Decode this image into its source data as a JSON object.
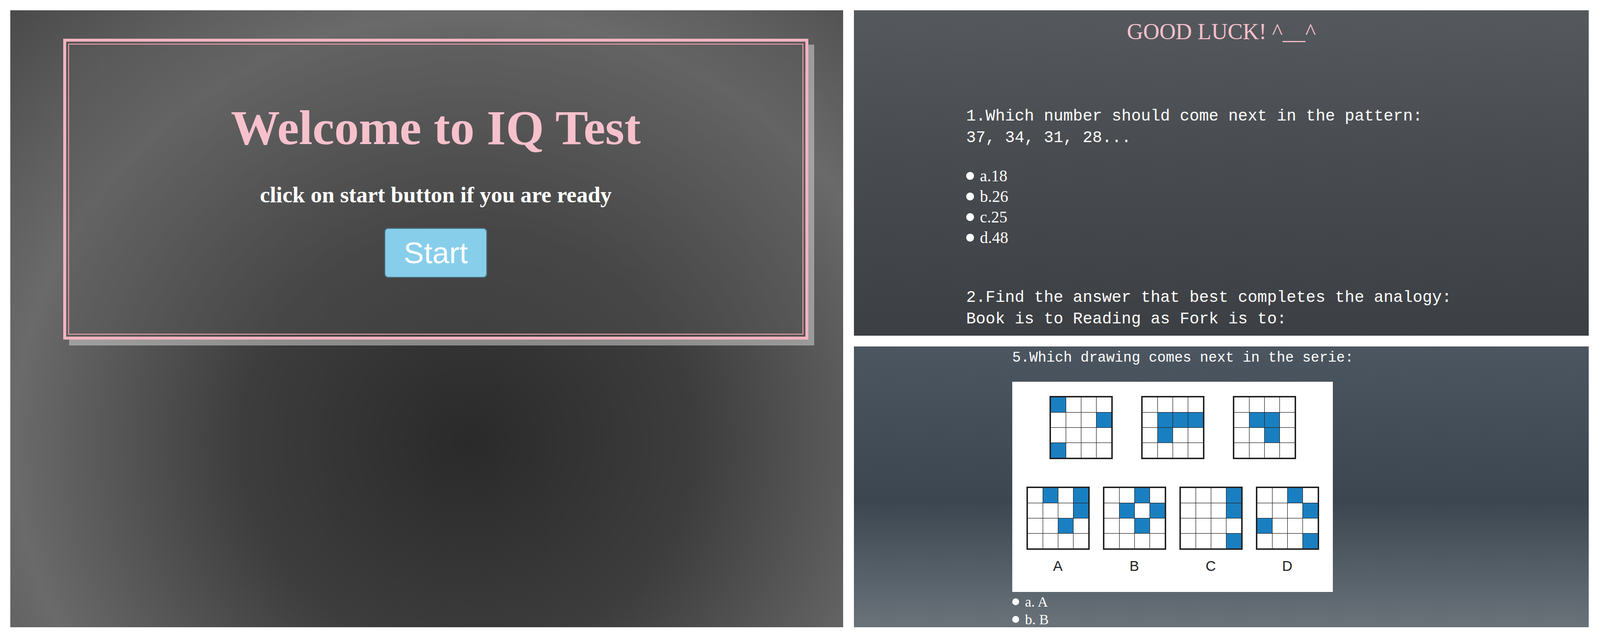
{
  "welcome": {
    "title": "Welcome to IQ Test",
    "subtitle": "click on start button if you are ready",
    "button": "Start"
  },
  "quiz_top": {
    "header": "GOOD LUCK! ^__^",
    "questions": [
      {
        "lines": [
          "1.Which number should come next in the pattern:",
          "37, 34, 31, 28..."
        ],
        "options": [
          "a.18",
          "b.26",
          "c.25",
          "d.48"
        ]
      },
      {
        "lines": [
          "2.Find the answer that best completes the analogy:",
          "Book is to Reading as Fork is to:"
        ],
        "options": []
      }
    ]
  },
  "quiz_bottom": {
    "question": "5.Which drawing comes next in the serie:",
    "series": [
      {
        "filled": [
          0,
          7,
          12
        ]
      },
      {
        "filled": [
          5,
          6,
          7,
          9
        ]
      },
      {
        "filled": [
          5,
          6,
          10
        ]
      }
    ],
    "choices": [
      {
        "label": "A",
        "filled": [
          1,
          3,
          7,
          10
        ]
      },
      {
        "label": "B",
        "filled": [
          2,
          5,
          7,
          10
        ]
      },
      {
        "label": "C",
        "filled": [
          3,
          7,
          15
        ]
      },
      {
        "label": "D",
        "filled": [
          2,
          7,
          8,
          15
        ]
      }
    ],
    "options": [
      "a. A",
      "b. B"
    ]
  }
}
